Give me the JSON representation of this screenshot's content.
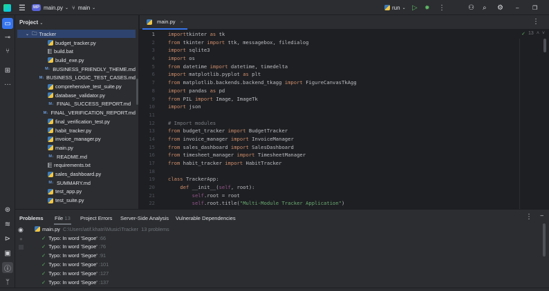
{
  "topbar": {
    "project_badge": "MP",
    "file": "main.py",
    "branch": "main",
    "run_config": "run"
  },
  "project": {
    "title": "Project",
    "root": "Tracker",
    "files": [
      {
        "name": "budget_tracker.py",
        "type": "py"
      },
      {
        "name": "build.bat",
        "type": "txt"
      },
      {
        "name": "build_exe.py",
        "type": "py"
      },
      {
        "name": "BUSINESS_FRIENDLY_THEME.md",
        "type": "md"
      },
      {
        "name": "BUSINESS_LOGIC_TEST_CASES.md",
        "type": "md"
      },
      {
        "name": "comprehensive_test_suite.py",
        "type": "py"
      },
      {
        "name": "database_validator.py",
        "type": "py"
      },
      {
        "name": "FINAL_SUCCESS_REPORT.md",
        "type": "md"
      },
      {
        "name": "FINAL_VERIFICATION_REPORT.md",
        "type": "md"
      },
      {
        "name": "final_verification_test.py",
        "type": "py"
      },
      {
        "name": "habit_tracker.py",
        "type": "py"
      },
      {
        "name": "invoice_manager.py",
        "type": "py"
      },
      {
        "name": "main.py",
        "type": "py"
      },
      {
        "name": "README.md",
        "type": "md"
      },
      {
        "name": "requirements.txt",
        "type": "txt"
      },
      {
        "name": "sales_dashboard.py",
        "type": "py"
      },
      {
        "name": "SUMMARY.md",
        "type": "md"
      },
      {
        "name": "test_app.py",
        "type": "py"
      },
      {
        "name": "test_suite.py",
        "type": "py"
      }
    ]
  },
  "editor": {
    "tab": "main.py",
    "inspection_count": "13",
    "lines": [
      [
        [
          "kw",
          "import"
        ],
        [
          "",
          "tkinter "
        ],
        [
          "kw",
          "as"
        ],
        [
          "",
          " tk"
        ]
      ],
      [
        [
          "kw",
          "from"
        ],
        [
          "",
          " tkinter "
        ],
        [
          "kw",
          "import"
        ],
        [
          "",
          " ttk, messagebox, filedialog"
        ]
      ],
      [
        [
          "kw",
          "import"
        ],
        [
          "",
          " sqlite3"
        ]
      ],
      [
        [
          "kw",
          "import"
        ],
        [
          "",
          " os"
        ]
      ],
      [
        [
          "kw",
          "from"
        ],
        [
          "",
          " datetime "
        ],
        [
          "kw",
          "import"
        ],
        [
          "",
          " datetime, timedelta"
        ]
      ],
      [
        [
          "kw",
          "import"
        ],
        [
          "",
          " matplotlib.pyplot "
        ],
        [
          "kw",
          "as"
        ],
        [
          "",
          " plt"
        ]
      ],
      [
        [
          "kw",
          "from"
        ],
        [
          "",
          " matplotlib.backends.backend_tkagg "
        ],
        [
          "kw",
          "import"
        ],
        [
          "",
          " FigureCanvasTkAgg"
        ]
      ],
      [
        [
          "kw",
          "import"
        ],
        [
          "",
          " pandas "
        ],
        [
          "kw",
          "as"
        ],
        [
          "",
          " pd"
        ]
      ],
      [
        [
          "kw",
          "from"
        ],
        [
          "",
          " PIL "
        ],
        [
          "kw",
          "import"
        ],
        [
          "",
          " Image, ImageTk"
        ]
      ],
      [
        [
          "kw",
          "import"
        ],
        [
          "",
          " json"
        ]
      ],
      [],
      [
        [
          "cm",
          "# Import modules"
        ]
      ],
      [
        [
          "kw",
          "from"
        ],
        [
          "",
          " budget_tracker "
        ],
        [
          "kw",
          "import"
        ],
        [
          "",
          " BudgetTracker"
        ]
      ],
      [
        [
          "kw",
          "from"
        ],
        [
          "",
          " invoice_manager "
        ],
        [
          "kw",
          "import"
        ],
        [
          "",
          " InvoiceManager"
        ]
      ],
      [
        [
          "kw",
          "from"
        ],
        [
          "",
          " sales_dashboard "
        ],
        [
          "kw",
          "import"
        ],
        [
          "",
          " SalesDashboard"
        ]
      ],
      [
        [
          "kw",
          "from"
        ],
        [
          "",
          " timesheet_manager "
        ],
        [
          "kw",
          "import"
        ],
        [
          "",
          " TimesheetManager"
        ]
      ],
      [
        [
          "kw",
          "from"
        ],
        [
          "",
          " habit_tracker "
        ],
        [
          "kw",
          "import"
        ],
        [
          "",
          " HabitTracker"
        ]
      ],
      [],
      [
        [
          "kw",
          "class"
        ],
        [
          "",
          " TrackerApp:"
        ]
      ],
      [
        [
          "",
          "    "
        ],
        [
          "kw",
          "def"
        ],
        [
          "",
          " __init__("
        ],
        [
          "sf",
          "self"
        ],
        [
          "",
          ", root):"
        ]
      ],
      [
        [
          "",
          "        "
        ],
        [
          "sf",
          "self"
        ],
        [
          "",
          ".root = root"
        ]
      ],
      [
        [
          "",
          "        "
        ],
        [
          "sf",
          "self"
        ],
        [
          "",
          ".root.title("
        ],
        [
          "st",
          "\"Multi-Module Tracker Application\""
        ],
        [
          "",
          ")"
        ]
      ]
    ]
  },
  "problems": {
    "tabs": [
      "Problems",
      "File",
      "Project Errors",
      "Server-Side Analysis",
      "Vulnerable Dependencies"
    ],
    "file_count": "13",
    "file": "main.py",
    "path": "C:\\Users\\atif.khatri\\Music\\Tracker",
    "summary": "13 problems",
    "items": [
      {
        "text": "Typo: In word 'Segoe'",
        "line": ":66"
      },
      {
        "text": "Typo: In word 'Segoe'",
        "line": ":76"
      },
      {
        "text": "Typo: In word 'Segoe'",
        "line": ":91"
      },
      {
        "text": "Typo: In word 'Segoe'",
        "line": ":101"
      },
      {
        "text": "Typo: In word 'Segoe'",
        "line": ":127"
      },
      {
        "text": "Typo: In word 'Segoe'",
        "line": ":137"
      }
    ]
  }
}
